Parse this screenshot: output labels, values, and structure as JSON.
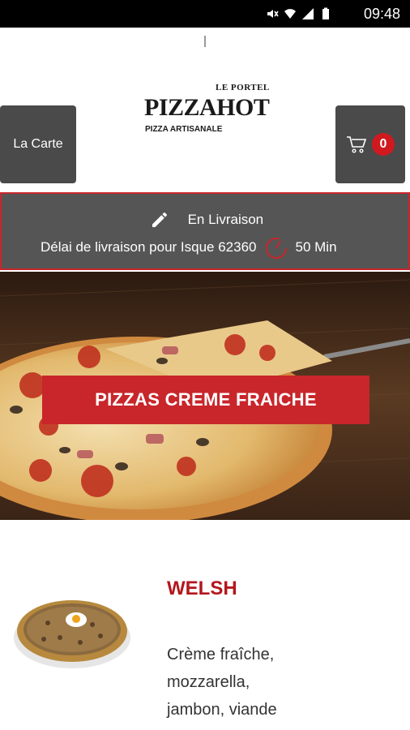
{
  "status_bar": {
    "time": "09:48"
  },
  "header": {
    "menu_button": "La Carte",
    "cart_count": "0",
    "logo": {
      "top": "LE PORTEL",
      "main": "PIZZAHOT",
      "sub": "PIZZA ARTISANALE"
    }
  },
  "delivery": {
    "mode": "En Livraison",
    "delay_label": "Délai de livraison pour Isque 62360",
    "delay_value": "50 Min"
  },
  "category": {
    "title": "PIZZAS CREME FRAICHE"
  },
  "product": {
    "name": "WELSH",
    "description_lines": [
      "Crème fraîche,",
      "mozzarella,",
      "jambon, viande"
    ]
  },
  "colors": {
    "accent": "#c8262b",
    "dark_button": "#4a4a4a",
    "banner_bar": "#555555"
  }
}
